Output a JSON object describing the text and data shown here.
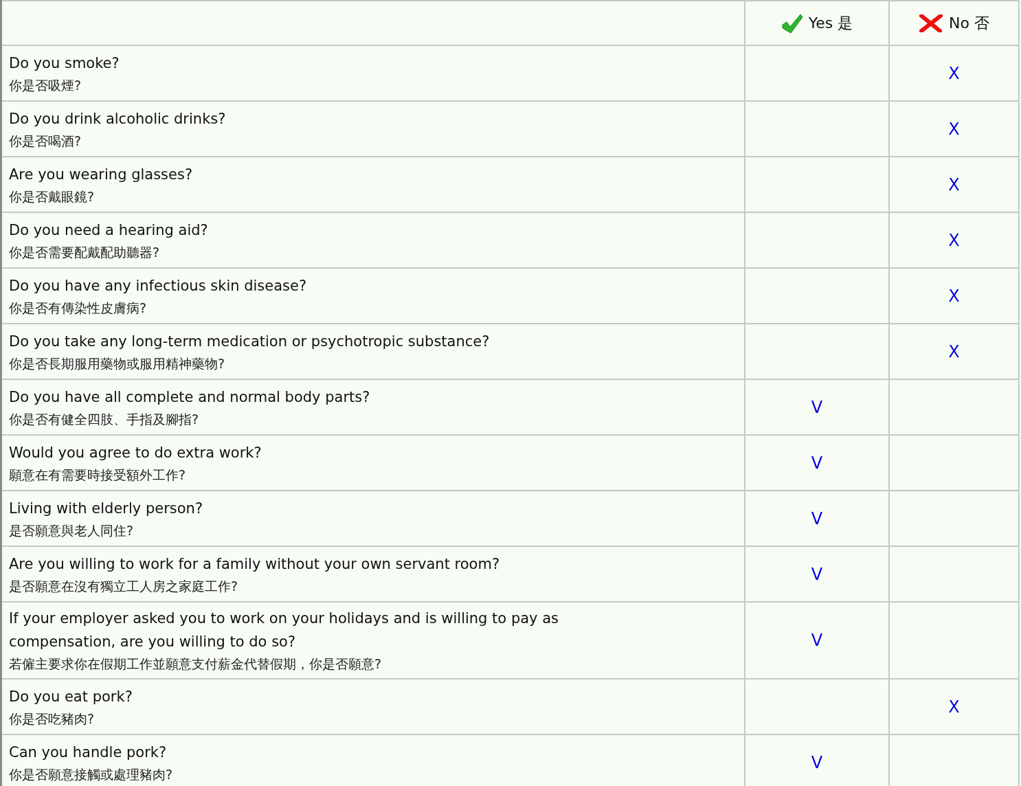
{
  "header": {
    "yes_label": "Yes 是",
    "no_label": "No 否"
  },
  "rows": [
    {
      "en": "Do you smoke?",
      "zh": "你是否吸煙?",
      "no_mark": "X"
    },
    {
      "en": "Do you drink alcoholic drinks?",
      "zh": "你是否喝酒?",
      "no_mark": "X"
    },
    {
      "en": "Are you wearing glasses?",
      "zh": "你是否戴眼鏡?",
      "no_mark": "X"
    },
    {
      "en": "Do you need a hearing aid?",
      "zh": "你是否需要配戴配助聽器?",
      "no_mark": "X"
    },
    {
      "en": "Do you have any infectious skin disease?",
      "zh": "你是否有傳染性皮膚病?",
      "no_mark": "X"
    },
    {
      "en": "Do you take any long-term medication or psychotropic substance?",
      "zh": "你是否長期服用藥物或服用精神藥物?",
      "no_mark": "X"
    },
    {
      "en": "Do you have all complete and normal body parts?",
      "zh": "你是否有健全四肢、手指及腳指?",
      "yes_mark": "V"
    },
    {
      "en": "Would you agree to do extra work?",
      "zh": "願意在有需要時接受額外工作?",
      "yes_mark": "V"
    },
    {
      "en": "Living with elderly person?",
      "zh": "是否願意與老人同住?",
      "yes_mark": "V"
    },
    {
      "en": "Are you willing to work for a family without your own servant room?",
      "zh": "是否願意在沒有獨立工人房之家庭工作?",
      "yes_mark": "V"
    },
    {
      "en": "If your employer asked you to work on your holidays and is willing to pay as compensation, are you willing to do so?",
      "zh": "若僱主要求你在假期工作並願意支付薪金代替假期，你是否願意?",
      "yes_mark": "V"
    },
    {
      "en": "Do you eat pork?",
      "zh": "你是否吃豬肉?",
      "no_mark": "X"
    },
    {
      "en": "Can you handle pork?",
      "zh": "你是否願意接觸或處理豬肉?",
      "yes_mark": "V"
    }
  ]
}
